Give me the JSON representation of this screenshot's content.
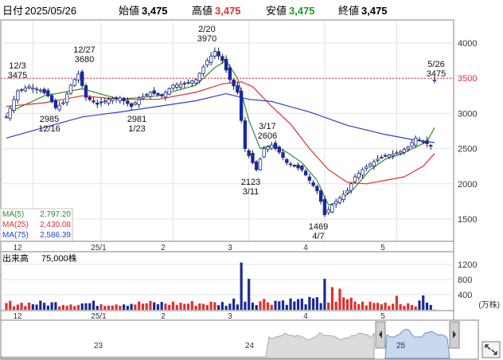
{
  "header": {
    "date_label": "日付",
    "date_value": "2025/05/26",
    "open_label": "始値",
    "open_value": "3,475",
    "high_label": "高値",
    "high_value": "3,475",
    "low_label": "安値",
    "low_value": "3,475",
    "close_label": "終値",
    "close_value": "3,475"
  },
  "ma_legend": [
    {
      "label": "MA(5)",
      "value": "2,797.20",
      "color": "#2e8b2e"
    },
    {
      "label": "MA(25)",
      "value": "2,430.08",
      "color": "#e03030"
    },
    {
      "label": "MA(75)",
      "value": "2,586.39",
      "color": "#2b3fc8"
    }
  ],
  "volume_header": {
    "label": "出来高",
    "value": "75,000株"
  },
  "volume_unit": "(万株)",
  "ref_line_value": 3500,
  "navigator": {
    "year_labels": [
      "23",
      "24",
      "25"
    ]
  },
  "colors": {
    "up": "#ffffff",
    "down": "#1a2a9a",
    "vol_up": "#e03030",
    "vol_down": "#1a2a9a",
    "ref_line": "#e03030",
    "border": "#808080"
  },
  "chart_data": [
    {
      "type": "candlestick",
      "x_axis": {
        "tick_labels": [
          "12",
          "25/1",
          "2",
          "3",
          "4",
          "5"
        ]
      },
      "y_axis": {
        "ticks": [
          1500,
          2000,
          2500,
          3000,
          3500,
          4000
        ],
        "range": [
          1300,
          4400
        ]
      },
      "annotations": [
        {
          "date": "12/3",
          "value": "3475"
        },
        {
          "date": "12/16",
          "value": "2985"
        },
        {
          "date": "12/27",
          "value": "3680"
        },
        {
          "date": "1/23",
          "value": "2981"
        },
        {
          "date": "2/20",
          "value": "3970"
        },
        {
          "date": "3/11",
          "value": "2123"
        },
        {
          "date": "3/17",
          "value": "2606"
        },
        {
          "date": "4/7",
          "value": "1469"
        },
        {
          "date": "5/26",
          "value": "3475"
        }
      ],
      "keypoints": [
        {
          "i": 0,
          "p": 2950
        },
        {
          "i": 3,
          "p": 3320
        },
        {
          "i": 6,
          "p": 3380
        },
        {
          "i": 9,
          "p": 3330
        },
        {
          "i": 11,
          "p": 3250
        },
        {
          "i": 13,
          "p": 3080
        },
        {
          "i": 15,
          "p": 3150
        },
        {
          "i": 17,
          "p": 3400
        },
        {
          "i": 19,
          "p": 3560
        },
        {
          "i": 21,
          "p": 3230
        },
        {
          "i": 24,
          "p": 3130
        },
        {
          "i": 27,
          "p": 3200
        },
        {
          "i": 30,
          "p": 3220
        },
        {
          "i": 33,
          "p": 3100
        },
        {
          "i": 35,
          "p": 3200
        },
        {
          "i": 38,
          "p": 3300
        },
        {
          "i": 41,
          "p": 3250
        },
        {
          "i": 44,
          "p": 3400
        },
        {
          "i": 47,
          "p": 3420
        },
        {
          "i": 50,
          "p": 3480
        },
        {
          "i": 53,
          "p": 3750
        },
        {
          "i": 55,
          "p": 3880
        },
        {
          "i": 57,
          "p": 3750
        },
        {
          "i": 59,
          "p": 3480
        },
        {
          "i": 61,
          "p": 3300
        },
        {
          "i": 63,
          "p": 2500
        },
        {
          "i": 65,
          "p": 2300
        },
        {
          "i": 66,
          "p": 2200
        },
        {
          "i": 68,
          "p": 2500
        },
        {
          "i": 70,
          "p": 2550
        },
        {
          "i": 72,
          "p": 2450
        },
        {
          "i": 74,
          "p": 2300
        },
        {
          "i": 76,
          "p": 2250
        },
        {
          "i": 78,
          "p": 2200
        },
        {
          "i": 80,
          "p": 2050
        },
        {
          "i": 82,
          "p": 1900
        },
        {
          "i": 83,
          "p": 1750
        },
        {
          "i": 84,
          "p": 1560
        },
        {
          "i": 86,
          "p": 1700
        },
        {
          "i": 88,
          "p": 1800
        },
        {
          "i": 90,
          "p": 1900
        },
        {
          "i": 92,
          "p": 2100
        },
        {
          "i": 94,
          "p": 2200
        },
        {
          "i": 96,
          "p": 2280
        },
        {
          "i": 98,
          "p": 2350
        },
        {
          "i": 100,
          "p": 2400
        },
        {
          "i": 102,
          "p": 2420
        },
        {
          "i": 104,
          "p": 2460
        },
        {
          "i": 106,
          "p": 2520
        },
        {
          "i": 108,
          "p": 2650
        },
        {
          "i": 110,
          "p": 2600
        },
        {
          "i": 112,
          "p": 2540
        },
        {
          "i": 113,
          "p": 3475
        }
      ],
      "ma_series": [
        {
          "name": "MA(5)",
          "color": "#2e8b2e",
          "points": [
            [
              0,
              3000
            ],
            [
              10,
              3250
            ],
            [
              20,
              3350
            ],
            [
              30,
              3200
            ],
            [
              40,
              3250
            ],
            [
              50,
              3400
            ],
            [
              55,
              3650
            ],
            [
              58,
              3750
            ],
            [
              61,
              3500
            ],
            [
              64,
              2900
            ],
            [
              67,
              2500
            ],
            [
              70,
              2550
            ],
            [
              74,
              2450
            ],
            [
              78,
              2300
            ],
            [
              82,
              2050
            ],
            [
              85,
              1700
            ],
            [
              88,
              1750
            ],
            [
              92,
              1950
            ],
            [
              96,
              2200
            ],
            [
              100,
              2350
            ],
            [
              104,
              2420
            ],
            [
              108,
              2520
            ],
            [
              111,
              2600
            ],
            [
              113,
              2797
            ]
          ]
        },
        {
          "name": "MA(25)",
          "color": "#e03030",
          "points": [
            [
              0,
              3100
            ],
            [
              10,
              3150
            ],
            [
              20,
              3250
            ],
            [
              30,
              3200
            ],
            [
              40,
              3200
            ],
            [
              50,
              3300
            ],
            [
              57,
              3420
            ],
            [
              62,
              3450
            ],
            [
              65,
              3380
            ],
            [
              70,
              3100
            ],
            [
              75,
              2850
            ],
            [
              80,
              2500
            ],
            [
              85,
              2200
            ],
            [
              90,
              2020
            ],
            [
              95,
              2000
            ],
            [
              100,
              2050
            ],
            [
              105,
              2100
            ],
            [
              110,
              2250
            ],
            [
              113,
              2430
            ]
          ]
        },
        {
          "name": "MA(75)",
          "color": "#2b3fc8",
          "points": [
            [
              0,
              2650
            ],
            [
              10,
              2800
            ],
            [
              20,
              2950
            ],
            [
              30,
              3020
            ],
            [
              40,
              3100
            ],
            [
              50,
              3180
            ],
            [
              58,
              3280
            ],
            [
              64,
              3200
            ],
            [
              70,
              3170
            ],
            [
              80,
              3020
            ],
            [
              90,
              2830
            ],
            [
              100,
              2700
            ],
            [
              108,
              2620
            ],
            [
              113,
              2586
            ]
          ]
        }
      ]
    },
    {
      "type": "bar",
      "title": "出来高",
      "y_axis": {
        "ticks": [
          400,
          800,
          1200
        ],
        "range": [
          0,
          1400
        ],
        "unit": "(万株)"
      },
      "spikes": [
        {
          "i": 62,
          "value": 1250
        },
        {
          "i": 64,
          "value": 820
        },
        {
          "i": 84,
          "value": 820
        },
        {
          "i": 86,
          "value": 600
        },
        {
          "i": 88,
          "value": 560
        },
        {
          "i": 103,
          "value": 370
        },
        {
          "i": 110,
          "value": 380
        }
      ],
      "base_level": 200
    }
  ]
}
